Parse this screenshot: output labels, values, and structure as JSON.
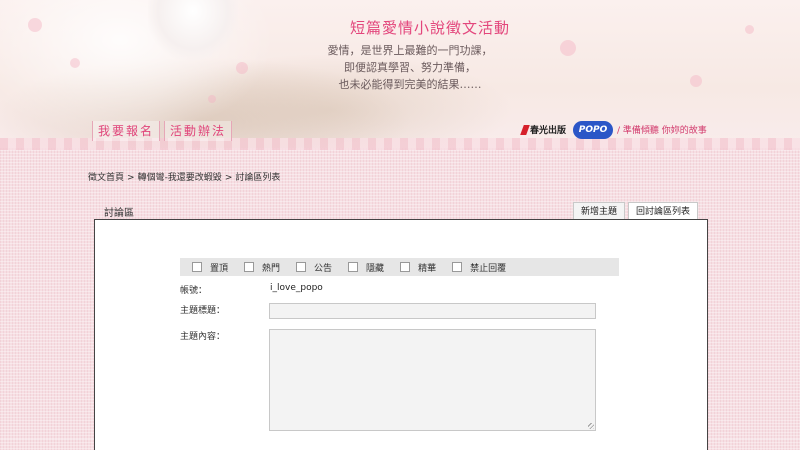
{
  "header": {
    "title": "短篇愛情小說徵文活動",
    "poem": [
      "愛情，是世界上最難的一門功課，",
      "即便認真學習、努力準備，",
      "也未必能得到完美的結果……"
    ],
    "nav": [
      "我要報名",
      "活動辦法"
    ],
    "brand_logo1": "春光出版",
    "brand_logo2": "POPO",
    "brand_tagline": "/ 準備傾聽 你妳的故事"
  },
  "breadcrumb": [
    "徵文首頁",
    "轉個彎-我還要改蝦毀",
    "討論區列表"
  ],
  "breadcrumb_sep": ">",
  "panel": {
    "label": "討論區",
    "tabs": [
      "新增主題",
      "回討論區列表"
    ]
  },
  "options": [
    "置頂",
    "熱門",
    "公告",
    "隱藏",
    "精華",
    "禁止回覆"
  ],
  "form": {
    "account_label": "帳號：",
    "account_value": "i_love_popo",
    "subject_label": "主題標題：",
    "subject_value": "",
    "content_label": "主題內容：",
    "content_value": ""
  },
  "colors": {
    "accent": "#e3467c",
    "background": "#f6dfe3"
  }
}
